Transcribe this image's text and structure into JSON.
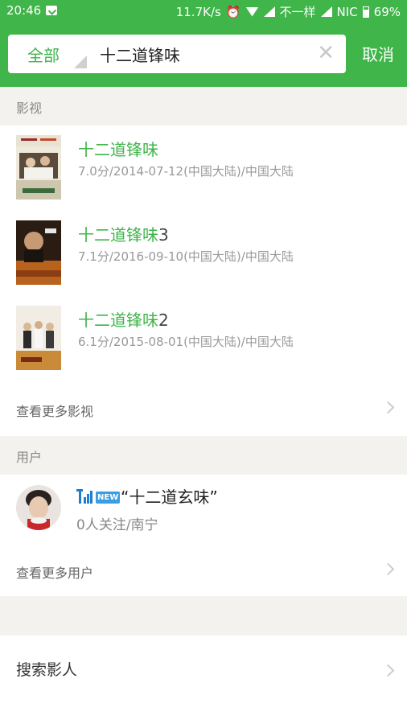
{
  "status_bar": {
    "time": "20:46",
    "speed": "11.7K/s",
    "carrier1": "不一样",
    "carrier2": "NIC",
    "battery": "69%"
  },
  "search": {
    "scope": "全部",
    "query": "十二道锋味",
    "clear_icon": "close-icon",
    "cancel_label": "取消"
  },
  "sections": {
    "movies_title": "影视",
    "users_title": "用户"
  },
  "movies": [
    {
      "title": "十二道锋味",
      "suffix": "",
      "info": "7.0分/2014-07-12(中国大陆)/中国大陆"
    },
    {
      "title": "十二道锋味",
      "suffix": "3",
      "info": "7.1分/2016-09-10(中国大陆)/中国大陆"
    },
    {
      "title": "十二道锋味",
      "suffix": "2",
      "info": "6.1分/2015-08-01(中国大陆)/中国大陆"
    }
  ],
  "more_movies_label": "查看更多影视",
  "user": {
    "name": "“十二道玄味”",
    "info": "0人关注/南宁",
    "badge_new": "NEW"
  },
  "more_users_label": "查看更多用户",
  "search_people_label": "搜索影人",
  "colors": {
    "brand": "#3fb54a",
    "section_bg": "#f4f2ee"
  }
}
